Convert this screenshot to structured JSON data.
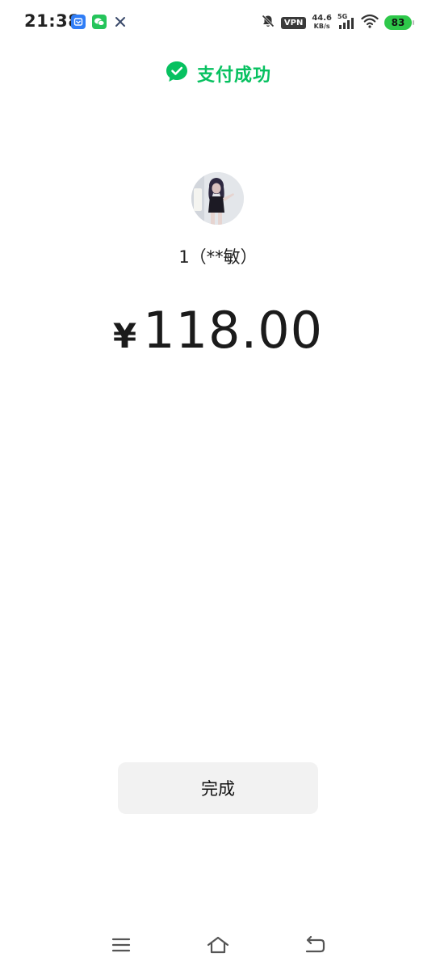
{
  "status_bar": {
    "time": "21:38",
    "notification_icons": [
      "mail-app-icon",
      "wechat-icon",
      "x-app-icon"
    ],
    "vpn": "VPN",
    "net_speed_value": "44.6",
    "net_speed_unit": "KB/s",
    "signal_label": "5G",
    "battery": "83"
  },
  "header": {
    "title": "支付成功",
    "accent_color": "#07c160"
  },
  "payee": {
    "name": "1（**敏）"
  },
  "amount": {
    "currency": "¥",
    "value": "118.00"
  },
  "actions": {
    "done_label": "完成"
  },
  "nav": {
    "icons": [
      "menu-icon",
      "home-icon",
      "back-icon"
    ]
  }
}
